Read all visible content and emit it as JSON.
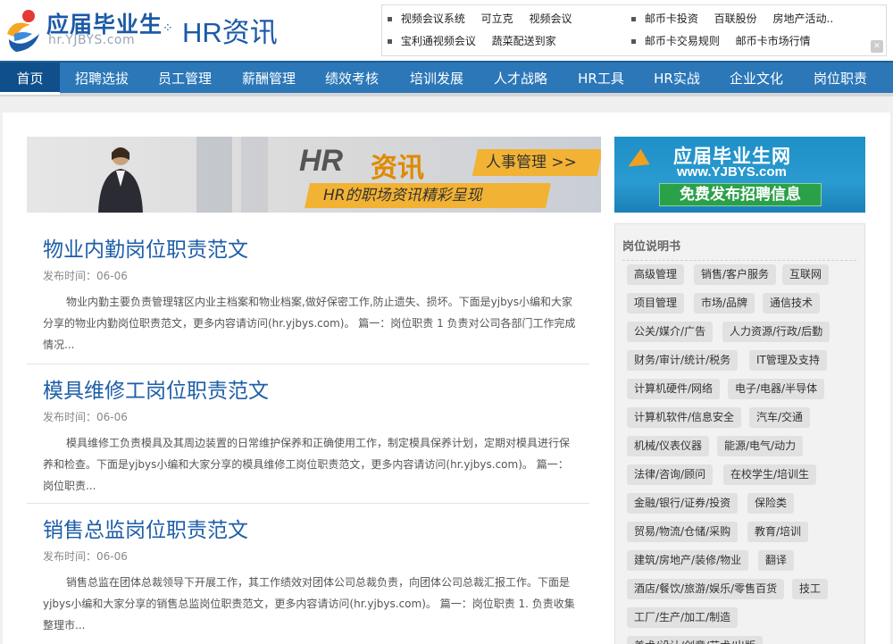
{
  "site": {
    "logo_cn": "应届毕业生",
    "logo_en": "hr.YJBYS.com",
    "section": "HR资讯"
  },
  "ads": {
    "left_col": [
      [
        "视频会议系统",
        "可立克",
        "视频会议"
      ],
      [
        "宝利通视频会议",
        "蔬菜配送到家"
      ]
    ],
    "right_col": [
      [
        "邮币卡投资",
        "百联股份",
        "房地产活动.."
      ],
      [
        "邮币卡交易规则",
        "邮币卡市场行情"
      ]
    ]
  },
  "nav": {
    "items": [
      "首页",
      "招聘选拔",
      "员工管理",
      "薪酬管理",
      "绩效考核",
      "培训发展",
      "人才战略",
      "HR工具",
      "HR实战",
      "企业文化",
      "岗位职责"
    ],
    "active_index": 0
  },
  "banner": {
    "hr": "HR",
    "zixun": "资讯",
    "tag1": "人事管理 >>",
    "tag2": "HR的职场资讯精彩呈现"
  },
  "right_banner": {
    "line1": "应届毕业生网",
    "line2": "www.YJBYS.com",
    "line3": "免费发布招聘信息"
  },
  "articles": [
    {
      "title": "物业内勤岗位职责范文",
      "date": "发布时间：06-06",
      "summary": "物业内勤主要负责管理辖区内业主档案和物业档案,做好保密工作,防止遗失、损坏。下面是yjbys小编和大家分享的物业内勤岗位职责范文，更多内容请访问(hr.yjbys.com)。 篇一：岗位职责 1 负责对公司各部门工作完成情况..."
    },
    {
      "title": "模具维修工岗位职责范文",
      "date": "发布时间：06-06",
      "summary": "模具维修工负责模具及其周边装置的日常维护保养和正确使用工作，制定模具保养计划，定期对模具进行保养和检查。下面是yjbys小编和大家分享的模具维修工岗位职责范文，更多内容请访问(hr.yjbys.com)。 篇一：岗位职责..."
    },
    {
      "title": "销售总监岗位职责范文",
      "date": "发布时间：06-06",
      "summary": "销售总监在团体总裁领导下开展工作，其工作绩效对团体公司总裁负责，向团体公司总裁汇报工作。下面是yjbys小编和大家分享的销售总监岗位职责范文，更多内容请访问(hr.yjbys.com)。 篇一：岗位职责 1. 负责收集整理市..."
    }
  ],
  "jobs": {
    "title": "岗位说明书",
    "rows": [
      [
        "高级管理",
        "销售/客户服务",
        "互联网"
      ],
      [
        "项目管理",
        "市场/品牌",
        "通信技术"
      ],
      [
        "公关/媒介/广告",
        "人力资源/行政/后勤"
      ],
      [
        "财务/审计/统计/税务",
        "IT管理及支持"
      ],
      [
        "计算机硬件/网络",
        "电子/电器/半导体"
      ],
      [
        "计算机软件/信息安全",
        "汽车/交通"
      ],
      [
        "机械/仪表仪器",
        "能源/电气/动力"
      ],
      [
        "法律/咨询/顾问",
        "在校学生/培训生"
      ],
      [
        "金融/银行/证券/投资",
        "保险类"
      ],
      [
        "贸易/物流/仓储/采购",
        "教育/培训"
      ],
      [
        "建筑/房地产/装修/物业",
        "翻译"
      ],
      [
        "酒店/餐饮/旅游/娱乐/零售百货",
        "技工"
      ],
      [
        "工厂/生产/加工/制造"
      ],
      [
        "美术/设计/创意/艺术/出版"
      ]
    ]
  },
  "colors": {
    "brand_blue": "#1d5ea8",
    "nav_blue": "#2b77b8",
    "nav_active": "#0f4f8c",
    "accent_orange": "#f2b233"
  }
}
